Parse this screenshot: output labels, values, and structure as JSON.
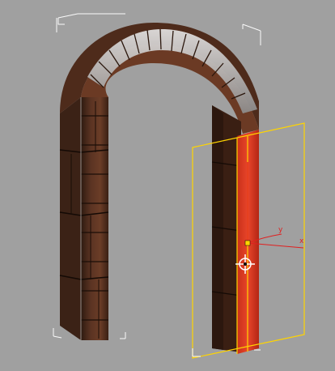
{
  "viewport": {
    "background": "#a0a0a0",
    "object": {
      "name": "brick-arch",
      "brick_color": "#4b2a1c",
      "mortar_color": "#d9d9d9"
    },
    "selection": {
      "color": "#ff3b1a",
      "frame_color": "#ffd400"
    },
    "gizmo": {
      "x_label": "x",
      "y_label": "y",
      "x_color": "#e02020",
      "y_color": "#e02020"
    },
    "move_cursor_icon": "move-crosshair-icon"
  }
}
